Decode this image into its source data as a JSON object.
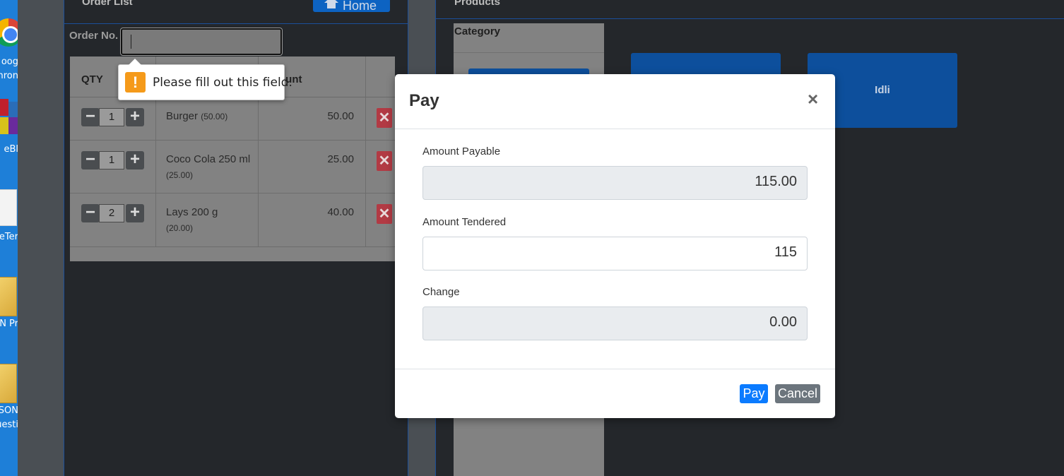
{
  "desktop": {
    "labels": [
      "oog",
      "hron",
      "eBl",
      "eTer",
      "N Pr",
      "SON",
      "uesti"
    ]
  },
  "order_panel": {
    "title": "Order List",
    "home_label": "Home",
    "order_no_label": "Order No.",
    "order_no_value": ""
  },
  "validation_tooltip": {
    "icon": "!",
    "message": "Please fill out this field."
  },
  "order_table": {
    "headers": {
      "qty": "QTY",
      "amount": "ount"
    },
    "rows": [
      {
        "qty": "1",
        "name": "Burger",
        "unit_price": "(50.00)",
        "amount": "50.00"
      },
      {
        "qty": "1",
        "name": "Coco Cola 250 ml",
        "unit_price": "(25.00)",
        "amount": "25.00"
      },
      {
        "qty": "2",
        "name": "Lays 200 g",
        "unit_price": "(20.00)",
        "amount": "40.00"
      }
    ],
    "minus_symbol": "−",
    "plus_symbol": "+",
    "remove_symbol": "✕"
  },
  "products_panel": {
    "title": "Products",
    "category_title": "Category",
    "products": [
      "",
      "Idli"
    ]
  },
  "pay_modal": {
    "title": "Pay",
    "close_symbol": "×",
    "amount_payable_label": "Amount Payable",
    "amount_payable_value": "115.00",
    "amount_tendered_label": "Amount Tendered",
    "amount_tendered_value": "115",
    "change_label": "Change",
    "change_value": "0.00",
    "pay_button": "Pay",
    "cancel_button": "Cancel"
  },
  "colors": {
    "primary": "#0b7bff",
    "secondary": "#6c757d",
    "danger": "#b23a44",
    "warning": "#f59a1a",
    "panel_border": "#1b4f9a"
  }
}
